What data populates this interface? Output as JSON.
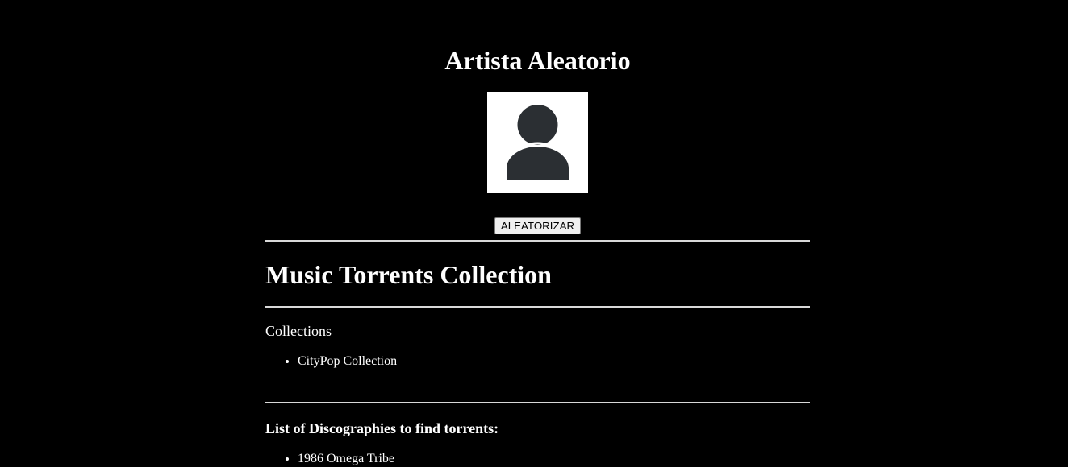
{
  "artist": {
    "title": "Artista Aleatorio",
    "avatar_icon": "user-silhouette-icon",
    "randomize_label": "ALEATORIZAR"
  },
  "main": {
    "title": "Music Torrents Collection"
  },
  "collections": {
    "heading": "Collections",
    "items": [
      "CityPop Collection"
    ]
  },
  "discographies": {
    "heading": "List of Discographies to find torrents:",
    "items": [
      "1986 Omega Tribe"
    ]
  },
  "colors": {
    "background": "#000000",
    "text": "#ffffff",
    "avatar_bg": "#ffffff",
    "avatar_icon": "#2b2f33",
    "divider": "#d8d8d8"
  }
}
